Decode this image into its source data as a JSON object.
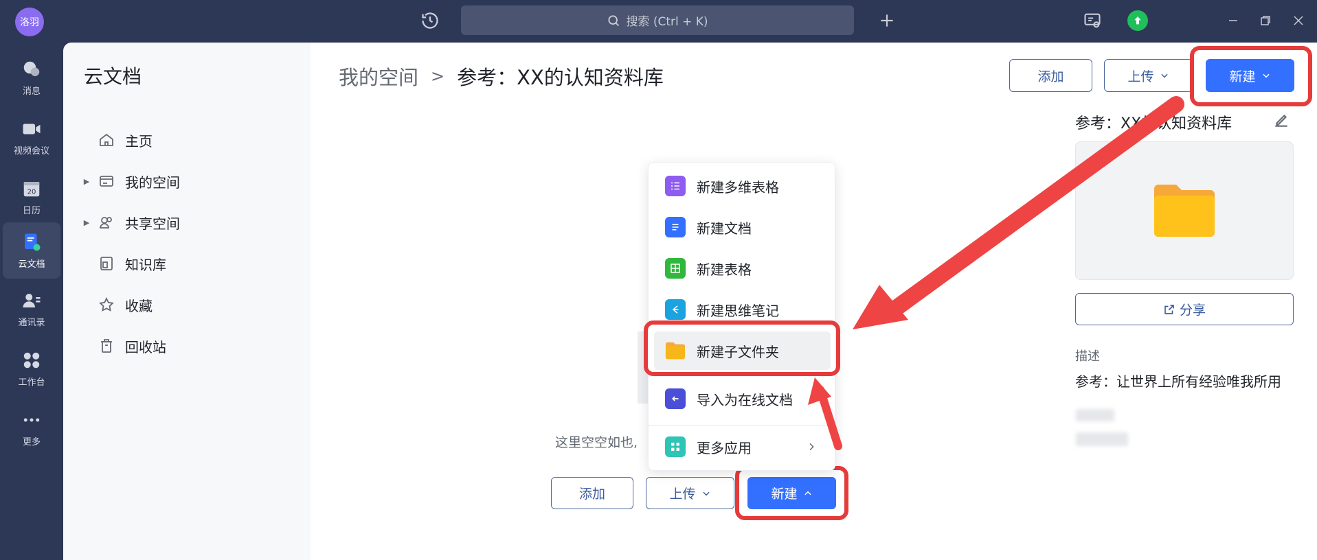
{
  "titlebar": {
    "avatar_text": "洛羽",
    "search_placeholder": "搜索 (Ctrl + K)",
    "history_icon": "history-icon",
    "plus_icon": "plus-icon",
    "upgrade_icon": "upload-arrow-icon"
  },
  "rail": [
    {
      "label": "消息",
      "icon": "chat-icon"
    },
    {
      "label": "视频会议",
      "icon": "video-icon"
    },
    {
      "label": "日历",
      "icon": "calendar-icon",
      "day": "20"
    },
    {
      "label": "云文档",
      "icon": "cloud-doc-icon"
    },
    {
      "label": "通讯录",
      "icon": "contacts-icon"
    },
    {
      "label": "工作台",
      "icon": "workspace-icon"
    },
    {
      "label": "更多",
      "icon": "more-icon"
    }
  ],
  "nav": {
    "title": "云文档",
    "items": [
      {
        "label": "主页",
        "icon": "home-icon"
      },
      {
        "label": "我的空间",
        "icon": "folder-icon"
      },
      {
        "label": "共享空间",
        "icon": "shared-icon"
      },
      {
        "label": "知识库",
        "icon": "wiki-icon"
      },
      {
        "label": "收藏",
        "icon": "star-icon"
      },
      {
        "label": "回收站",
        "icon": "trash-icon"
      }
    ]
  },
  "breadcrumb": {
    "root": "我的空间",
    "separator": ">",
    "current": "参考：XX的认知资料库"
  },
  "toolbar": {
    "add_label": "添加",
    "upload_label": "上传",
    "new_label": "新建"
  },
  "detail": {
    "title": "参考：XX的认知资料库",
    "share_label": "分享",
    "desc_label": "描述",
    "desc_text": "参考：让世界上所有经验唯我所用"
  },
  "empty": {
    "text": "这里空空如也,"
  },
  "dropdown": {
    "items": [
      {
        "label": "新建多维表格",
        "icon": "bitable-icon",
        "color": "#8e5cf0"
      },
      {
        "label": "新建文档",
        "icon": "doc-icon",
        "color": "#3370ff"
      },
      {
        "label": "新建表格",
        "icon": "sheet-icon",
        "color": "#2fb83c"
      },
      {
        "label": "新建思维笔记",
        "icon": "mindnote-icon",
        "color": "#1aa3e0"
      },
      {
        "label": "新建子文件夹",
        "icon": "folder-icon",
        "color": "#f7b71a"
      },
      {
        "label": "导入为在线文档",
        "icon": "import-icon",
        "color": "#4b4fd8"
      },
      {
        "label": "更多应用",
        "icon": "apps-icon",
        "color": "#2ec4b6"
      }
    ]
  },
  "colors": {
    "accent": "#3370ff",
    "highlight": "#e63b3b",
    "rail_bg": "#2d3756"
  }
}
